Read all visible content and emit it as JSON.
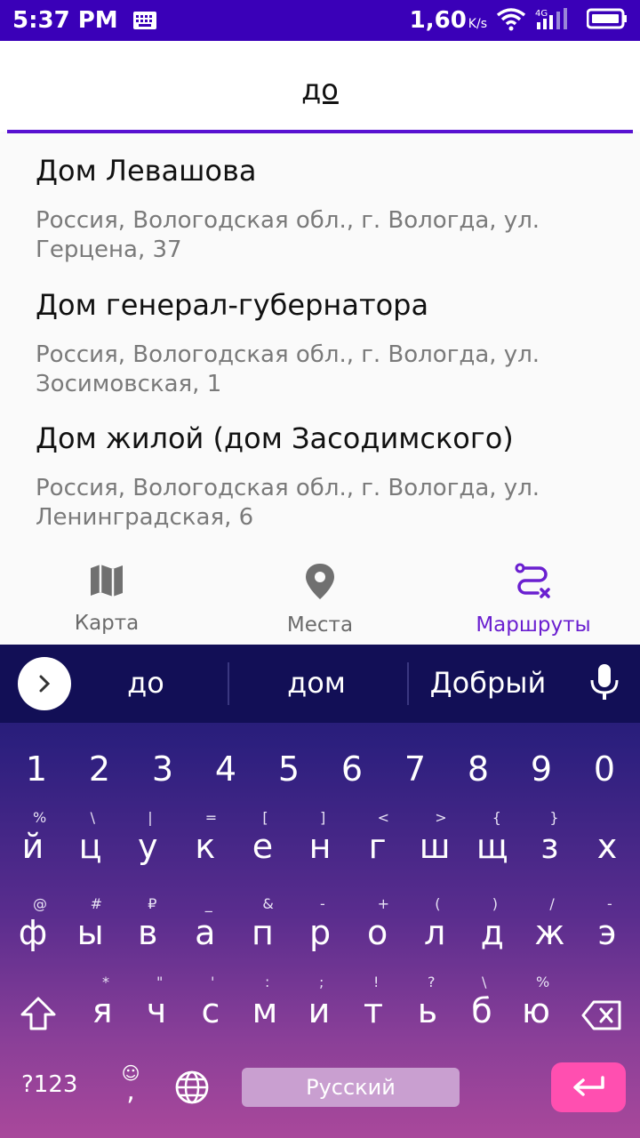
{
  "status_bar": {
    "time": "5:37 PM",
    "speed": "1,60",
    "speed_unit": "K/s",
    "network": "4G",
    "icons": [
      "keyboard-icon",
      "wifi-icon",
      "signal-icon",
      "battery-icon"
    ]
  },
  "search": {
    "value": "до"
  },
  "suggestions": [
    {
      "title": "Дом Левашова",
      "address_line1": "Россия, Вологодская обл., г. Вологда, ул.",
      "address_line2": "Герцена, 37"
    },
    {
      "title": "Дом генерал-губернатора",
      "address_line1": "Россия, Вологодская обл., г. Вологда, ул.",
      "address_line2": "Зосимовская, 1"
    },
    {
      "title": "Дом жилой (дом Засодимского)",
      "address_line1": "Россия, Вологодская обл., г. Вологда, ул.",
      "address_line2": "Ленинградская, 6"
    }
  ],
  "bottom_nav": {
    "items": [
      {
        "label": "Карта",
        "icon": "map-icon"
      },
      {
        "label": "Места",
        "icon": "location-pin-icon"
      },
      {
        "label": "Маршруты",
        "icon": "route-icon",
        "active": true
      }
    ],
    "active_color": "#6a1fd0"
  },
  "keyboard": {
    "suggestions": [
      "до",
      "дом",
      "Добрый"
    ],
    "numbers": [
      "1",
      "2",
      "3",
      "4",
      "5",
      "6",
      "7",
      "8",
      "9",
      "0"
    ],
    "row1": [
      "й",
      "ц",
      "у",
      "к",
      "е",
      "н",
      "г",
      "ш",
      "щ",
      "з",
      "х"
    ],
    "row1_hints": [
      "%",
      "\\",
      "|",
      "=",
      "[",
      "]",
      "<",
      ">",
      "{",
      "}",
      ""
    ],
    "row2": [
      "ф",
      "ы",
      "в",
      "а",
      "п",
      "р",
      "о",
      "л",
      "д",
      "ж",
      "э"
    ],
    "row2_hints": [
      "@",
      "#",
      "₽",
      "_",
      "&",
      "-",
      "+",
      "(",
      ")",
      "/",
      "-"
    ],
    "row3": [
      "я",
      "ч",
      "с",
      "м",
      "и",
      "т",
      "ь",
      "б",
      "ю"
    ],
    "row3_hints": [
      "*",
      "\"",
      "'",
      ":",
      ";",
      "!",
      "?",
      "\\",
      "%"
    ],
    "symbols_label": "?123",
    "emoji_label": "☺",
    "comma_label": ",",
    "space_label": "Русский",
    "enter_color": "#ff4fb0"
  }
}
